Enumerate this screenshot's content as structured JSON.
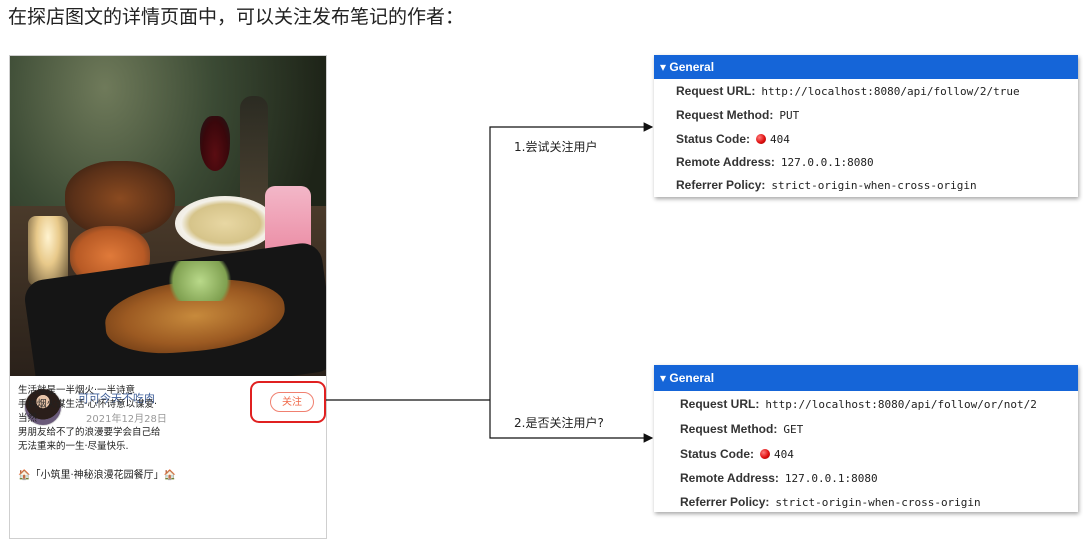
{
  "heading": "在探店图文的详情页面中，可以关注发布笔记的作者：",
  "post": {
    "author_name": "可可今天不吃肉",
    "date": "2021年12月28日",
    "follow_label": "关注",
    "body_lines": [
      "生活就是一半烟火·一半诗意",
      "手执烟火谋生活·心怀诗意以谋爱·",
      "当然",
      "男朋友给不了的浪漫要学会自己给",
      "无法重来的一生·尽量快乐."
    ],
    "title_line": "🏠「小筑里·神秘浪漫花园餐厅」🏠"
  },
  "arrows": {
    "label_1": "1.尝试关注用户",
    "label_2": "2.是否关注用户?"
  },
  "panel1": {
    "header": "▾ General",
    "rows": {
      "url_key": "Request URL:",
      "url_val": "http://localhost:8080/api/follow/2/true",
      "method_key": "Request Method:",
      "method_val": "PUT",
      "status_key": "Status Code:",
      "status_val": "404",
      "remote_key": "Remote Address:",
      "remote_val": "127.0.0.1:8080",
      "referrer_key": "Referrer Policy:",
      "referrer_val": "strict-origin-when-cross-origin"
    }
  },
  "panel2": {
    "header": "▾ General",
    "rows": {
      "url_key": "Request URL:",
      "url_val": "http://localhost:8080/api/follow/or/not/2",
      "method_key": "Request Method:",
      "method_val": "GET",
      "status_key": "Status Code:",
      "status_val": "404",
      "remote_key": "Remote Address:",
      "remote_val": "127.0.0.1:8080",
      "referrer_key": "Referrer Policy:",
      "referrer_val": "strict-origin-when-cross-origin"
    }
  },
  "colors": {
    "panel_header": "#1565d8",
    "follow_highlight": "#e02020",
    "follow_button": "#f06a4a",
    "status_error": "#e01010"
  }
}
